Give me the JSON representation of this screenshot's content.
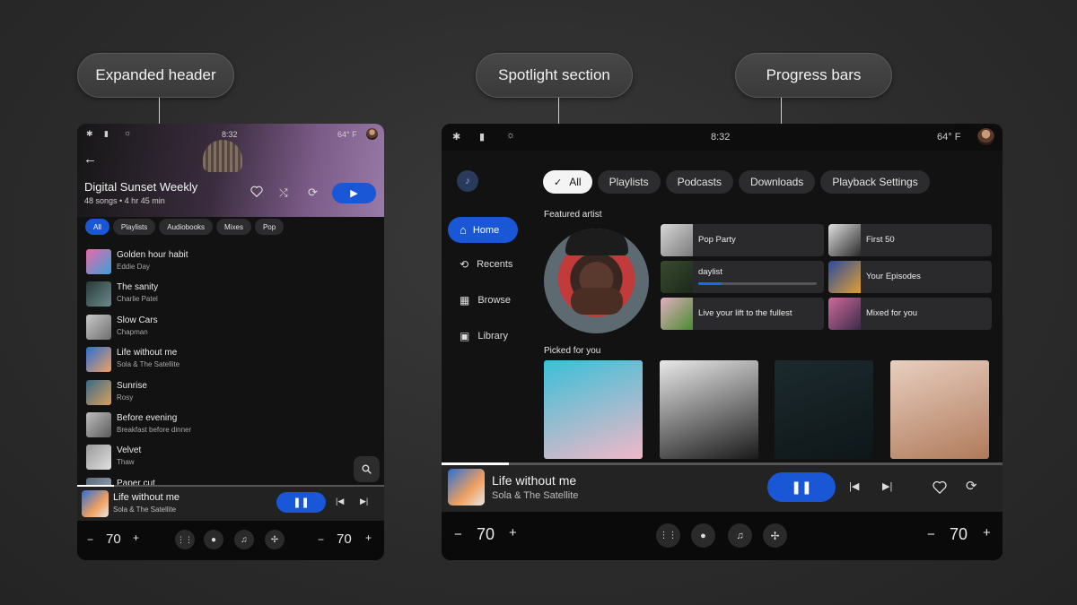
{
  "callouts": {
    "expanded_header": "Expanded header",
    "spotlight_section": "Spotlight section",
    "progress_bars": "Progress bars"
  },
  "left": {
    "time": "8:32",
    "temp": "64° F",
    "header": {
      "title": "Digital Sunset Weekly",
      "subtitle": "48 songs • 4 hr 45 min"
    },
    "chips": [
      "All",
      "Playlists",
      "Audiobooks",
      "Mixes",
      "Pop"
    ],
    "tracks": [
      {
        "title": "Golden hour habit",
        "artist": "Eddie Day",
        "c1": "#e86aa8",
        "c2": "#3aa0d8"
      },
      {
        "title": "The sanity",
        "artist": "Charlie Patel",
        "c1": "#2a3a3a",
        "c2": "#6a8a8a"
      },
      {
        "title": "Slow Cars",
        "artist": "Chapman",
        "c1": "#c9c9c9",
        "c2": "#6d6d6d"
      },
      {
        "title": "Life without me",
        "artist": "Sola & The Satellite",
        "c1": "#2b6fd6",
        "c2": "#f0a060"
      },
      {
        "title": "Sunrise",
        "artist": "Rosy",
        "c1": "#3a6a8a",
        "c2": "#d9a05a"
      },
      {
        "title": "Before evening",
        "artist": "Breakfast before dinner",
        "c1": "#bfbfbf",
        "c2": "#5a5a5a"
      },
      {
        "title": "Velvet",
        "artist": "Thaw",
        "c1": "#9a9a9a",
        "c2": "#e0e0e0"
      },
      {
        "title": "Paper cut",
        "artist": "",
        "c1": "#5a6a7a",
        "c2": "#a0b0c0"
      }
    ],
    "now_playing": {
      "title": "Life without me",
      "artist": "Sola & The Satellite",
      "progress": 0.12
    },
    "volume_left": "70",
    "volume_right": "70"
  },
  "right": {
    "time": "8:32",
    "temp": "64° F",
    "nav": [
      "Home",
      "Recents",
      "Browse",
      "Library"
    ],
    "chips": [
      "All",
      "Playlists",
      "Podcasts",
      "Downloads",
      "Playback Settings"
    ],
    "featured_label": "Featured artist",
    "tiles": [
      {
        "label": "Pop Party",
        "c1": "#d8d8d8",
        "c2": "#7a7a7a"
      },
      {
        "label": "First 50",
        "c1": "#e0e0e0",
        "c2": "#2a2a2a"
      },
      {
        "label": "daylist",
        "c1": "#3a4a30",
        "c2": "#1a2a18",
        "progress": 0.2
      },
      {
        "label": "Your Episodes",
        "c1": "#2a4aa0",
        "c2": "#e0a030"
      },
      {
        "label": "Live your lift to the fullest",
        "c1": "#e0b0c0",
        "c2": "#4a8a30"
      },
      {
        "label": "Mixed for you",
        "c1": "#d06a9a",
        "c2": "#3a2a4a"
      }
    ],
    "picked_label": "Picked for you",
    "picked": [
      {
        "c1": "#3ac0d8",
        "c2": "#f0b8c8"
      },
      {
        "c1": "#e8e8e8",
        "c2": "#1a1a1a"
      },
      {
        "c1": "#1c2a2e",
        "c2": "#0e1618"
      },
      {
        "c1": "#e8cfc0",
        "c2": "#b07a5a"
      }
    ],
    "now_playing": {
      "title": "Life without me",
      "artist": "Sola & The Satellite",
      "progress": 0.12
    },
    "volume_left": "70",
    "volume_right": "70"
  }
}
